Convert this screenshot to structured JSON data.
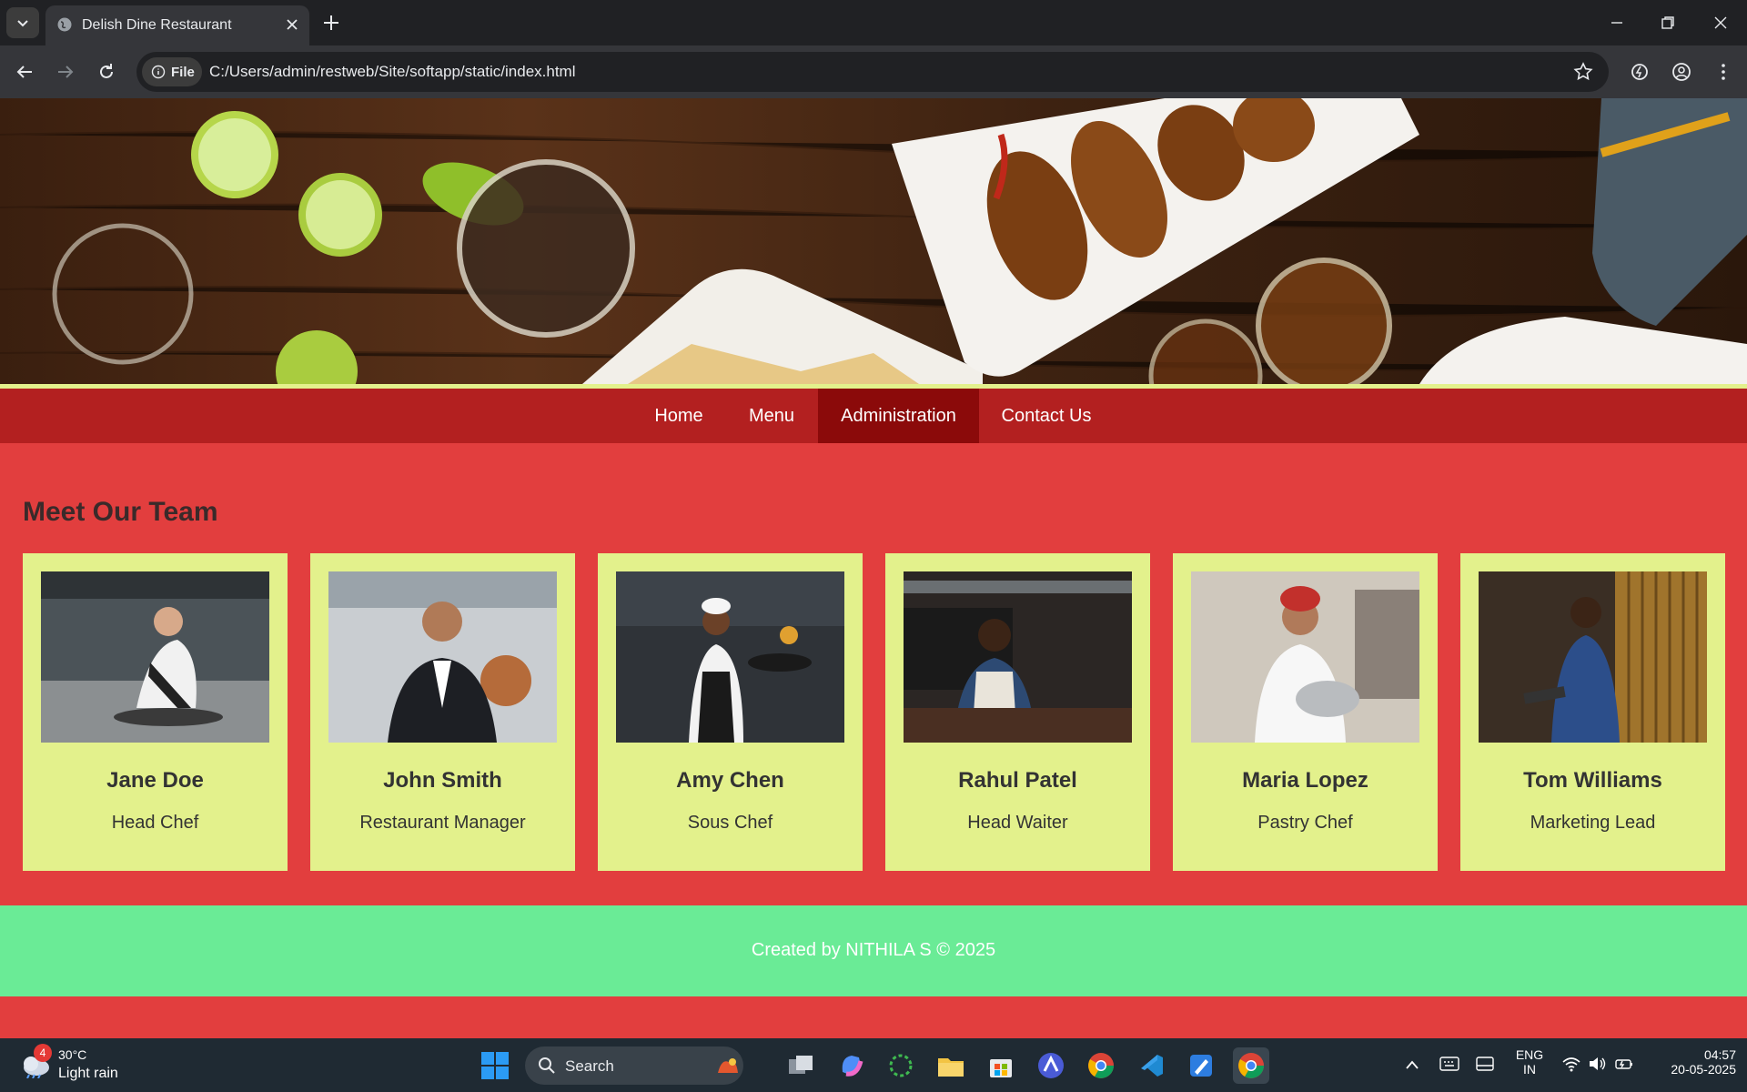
{
  "browser": {
    "tab_title": "Delish Dine Restaurant",
    "chip_label": "File",
    "url": "C:/Users/admin/restweb/Site/softapp/static/index.html"
  },
  "nav": {
    "items": [
      {
        "label": "Home",
        "active": false
      },
      {
        "label": "Menu",
        "active": false
      },
      {
        "label": "Administration",
        "active": true
      },
      {
        "label": "Contact Us",
        "active": false
      }
    ]
  },
  "team": {
    "title": "Meet Our Team",
    "members": [
      {
        "name": "Jane Doe",
        "role": "Head Chef"
      },
      {
        "name": "John Smith",
        "role": "Restaurant Manager"
      },
      {
        "name": "Amy Chen",
        "role": "Sous Chef"
      },
      {
        "name": "Rahul Patel",
        "role": "Head Waiter"
      },
      {
        "name": "Maria Lopez",
        "role": "Pastry Chef"
      },
      {
        "name": "Tom Williams",
        "role": "Marketing Lead"
      }
    ]
  },
  "footer": {
    "text": "Created by NITHILA S © 2025"
  },
  "taskbar": {
    "weather_badge": "4",
    "temperature": "30°C",
    "weather": "Light rain",
    "search_label": "Search",
    "lang_top": "ENG",
    "lang_bottom": "IN",
    "time": "04:57",
    "date": "20-05-2025"
  },
  "colors": {
    "page_bg": "#e23e3e",
    "navbar": "#b32020",
    "nav_active": "#8b0a0a",
    "card_bg": "#e3f18c",
    "footer_bg": "#6aeb96"
  }
}
